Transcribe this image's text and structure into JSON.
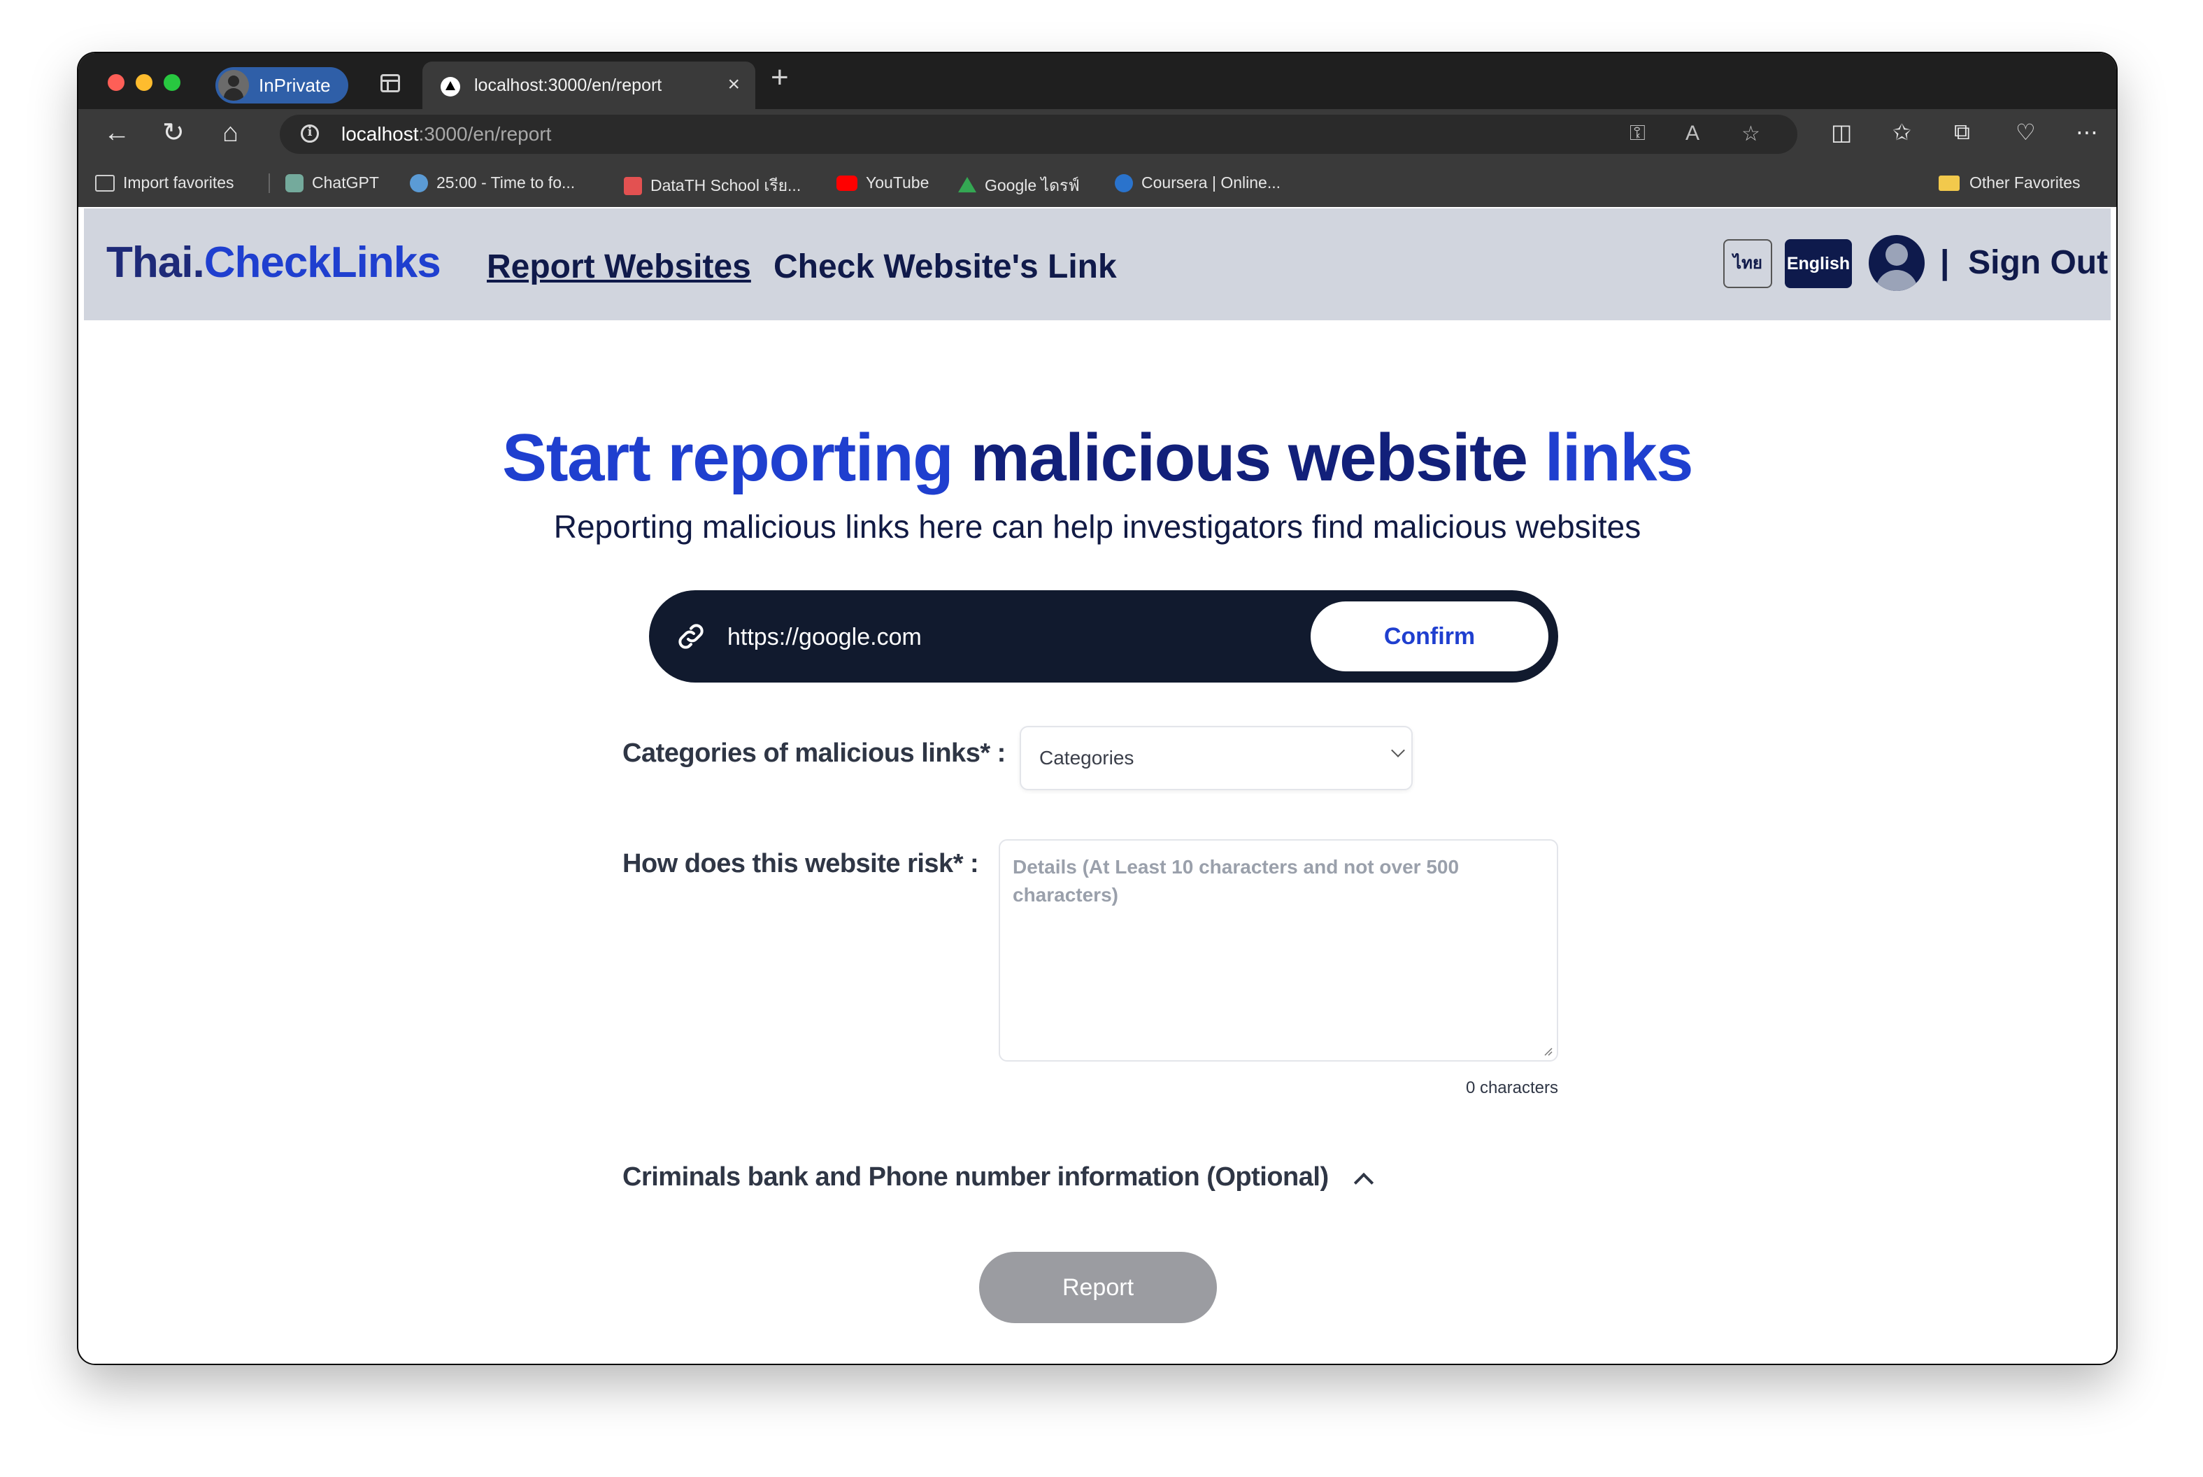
{
  "browser": {
    "profile_badge": "InPrivate",
    "tab_title": "localhost:3000/en/report",
    "address": {
      "host": "localhost",
      "path": ":3000/en/report"
    },
    "favorites": [
      {
        "label": "Import favorites"
      },
      {
        "label": "ChatGPT"
      },
      {
        "label": "25:00 - Time to fo..."
      },
      {
        "label": "DataTH School เรีย..."
      },
      {
        "label": "YouTube"
      },
      {
        "label": "Google ไดรฟ์"
      },
      {
        "label": "Coursera | Online..."
      }
    ],
    "other_favorites": "Other Favorites"
  },
  "header": {
    "brand_part1": "Thai.",
    "brand_part2": "CheckLinks",
    "nav_report": "Report Websites",
    "nav_check": "Check Website's Link",
    "lang_th": "ไทย",
    "lang_en": "English",
    "separator": "|",
    "signout": "Sign Out"
  },
  "hero": {
    "title_part1": "Start reporting",
    "title_part2": "malicious website",
    "title_part3": "links",
    "subtitle": "Reporting malicious links here can help investigators find malicious websites"
  },
  "url_form": {
    "value": "https://google.com",
    "confirm_label": "Confirm"
  },
  "form": {
    "categories_label": "Categories of malicious links* :",
    "categories_value": "Categories",
    "risk_label": "How does this website risk* :",
    "risk_placeholder": "Details (At Least 10 characters and not over 500 characters)",
    "char_count": "0 characters",
    "optional_label": "Criminals bank and Phone number information (Optional)",
    "report_label": "Report"
  },
  "footer_mark": ":",
  "colors": {
    "brand_dark": "#12207a",
    "brand_blue": "#1f3fcf",
    "header_bg": "#d1d5de",
    "url_bar_bg": "#111a2e",
    "report_disabled": "#9b9ca1"
  }
}
